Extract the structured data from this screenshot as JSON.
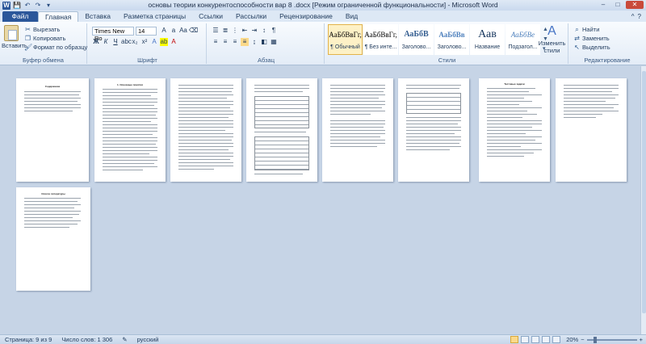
{
  "window": {
    "title": "основы теории конкурентоспособности вар 8 .docx [Режим ограниченной функциональности]  -  Microsoft Word",
    "minimize": "–",
    "maximize": "□",
    "close": "✕"
  },
  "qat": {
    "logo": "W",
    "save": "💾",
    "undo": "↶",
    "redo": "↷",
    "customize": "▾"
  },
  "tabs": {
    "file": "Файл",
    "items": [
      "Главная",
      "Вставка",
      "Разметка страницы",
      "Ссылки",
      "Рассылки",
      "Рецензирование",
      "Вид"
    ],
    "active_index": 0,
    "help": "?",
    "collapse": "^"
  },
  "clipboard": {
    "paste": "Вставить",
    "cut": "Вырезать",
    "copy": "Копировать",
    "format_painter": "Формат по образцу",
    "label": "Буфер обмена"
  },
  "font": {
    "name": "Times New Ro",
    "size": "14",
    "bold": "Ж",
    "italic": "К",
    "underline": "Ч",
    "label": "Шрифт"
  },
  "paragraph": {
    "label": "Абзац"
  },
  "styles": {
    "items": [
      {
        "sample": "АаБбВвГг,",
        "name": "¶ Обычный",
        "selected": true
      },
      {
        "sample": "АаБбВвГг,",
        "name": "¶ Без инте..."
      },
      {
        "sample": "АаБбВ",
        "name": "Заголово..."
      },
      {
        "sample": "АаБбВв",
        "name": "Заголово..."
      },
      {
        "sample": "Аав",
        "name": "Название"
      },
      {
        "sample": "АаБбВе",
        "name": "Подзагол..."
      }
    ],
    "change": "Изменить стили",
    "label": "Стили"
  },
  "editing": {
    "find": "Найти",
    "replace": "Заменить",
    "select": "Выделить",
    "label": "Редактирование"
  },
  "status": {
    "page": "Страница: 9 из 9",
    "words": "Число слов: 1 306",
    "language": "русский",
    "zoom": "20%",
    "zoom_minus": "−",
    "zoom_plus": "+"
  },
  "pages": [
    {
      "id": 1,
      "heading": "Содержание"
    },
    {
      "id": 2,
      "heading": "1. Основные понятия"
    },
    {
      "id": 3
    },
    {
      "id": 4,
      "has_table": true
    },
    {
      "id": 5
    },
    {
      "id": 6,
      "has_table": true
    },
    {
      "id": 7,
      "heading": "Тестовые задачи"
    },
    {
      "id": 8
    },
    {
      "id": 9,
      "heading": "Список литературы"
    }
  ]
}
